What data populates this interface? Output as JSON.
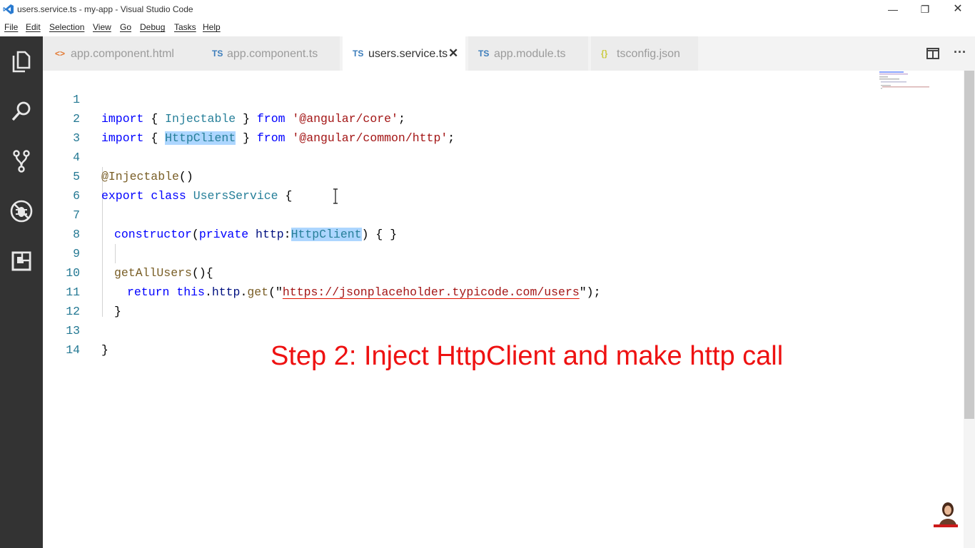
{
  "window": {
    "title": "users.service.ts - my-app - Visual Studio Code",
    "controls": {
      "minimize": "—",
      "restore": "❐",
      "close": "✕"
    }
  },
  "menu": [
    "File",
    "Edit",
    "Selection",
    "View",
    "Go",
    "Debug",
    "Tasks",
    "Help"
  ],
  "activity_bar": [
    "explorer-icon",
    "search-icon",
    "source-control-icon",
    "debug-icon",
    "extensions-icon"
  ],
  "tabs": [
    {
      "icon": "<>",
      "label": "app.component.html",
      "active": false
    },
    {
      "icon": "TS",
      "label": "app.component.ts",
      "active": false
    },
    {
      "icon": "TS",
      "label": "users.service.ts",
      "active": true,
      "close": "✕"
    },
    {
      "icon": "TS",
      "label": "app.module.ts",
      "active": false
    },
    {
      "icon": "{}",
      "label": "tsconfig.json",
      "active": false
    }
  ],
  "editor_actions": {
    "split": "split-editor-icon",
    "more": "···"
  },
  "code": {
    "line_numbers": [
      "1",
      "2",
      "3",
      "4",
      "5",
      "6",
      "7",
      "8",
      "9",
      "10",
      "11",
      "12",
      "13",
      "14"
    ],
    "l1": {
      "kw1": "import",
      "p1": " { ",
      "id": "Injectable",
      "p2": " } ",
      "kw2": "from",
      "sp": " ",
      "str": "'@angular/core'",
      "end": ";"
    },
    "l2": {
      "kw1": "import",
      "p1": " { ",
      "id": "HttpClient",
      "p2": " } ",
      "kw2": "from",
      "sp": " ",
      "str": "'@angular/common/http'",
      "end": ";"
    },
    "l4": {
      "dec": "@Injectable",
      "end": "()"
    },
    "l5": {
      "kw1": "export",
      "sp1": " ",
      "kw2": "class",
      "sp2": " ",
      "name": "UsersService",
      "end": " {"
    },
    "l7": {
      "kw1": "constructor",
      "p1": "(",
      "kw2": "private",
      "sp": " ",
      "param": "http",
      "colon": ":",
      "type": "HttpClient",
      "end": ") { }"
    },
    "l9": {
      "fn": "getAllUsers",
      "end": "(){"
    },
    "l10": {
      "kw": "return",
      "sp": " ",
      "this": "this",
      "dot1": ".",
      "prop": "http",
      "dot2": ".",
      "fn": "get",
      "p1": "(\"",
      "url": "https://jsonplaceholder.typicode.com/users",
      "end": "\");"
    },
    "l11": {
      "text": "}"
    },
    "l13": {
      "text": "}"
    }
  },
  "caption": "Step 2: Inject HttpClient  and make http call",
  "colors": {
    "caption": "#ee1111",
    "activity_bar": "#333333",
    "keyword": "#0000ff",
    "string": "#a31515",
    "type": "#267f99"
  }
}
